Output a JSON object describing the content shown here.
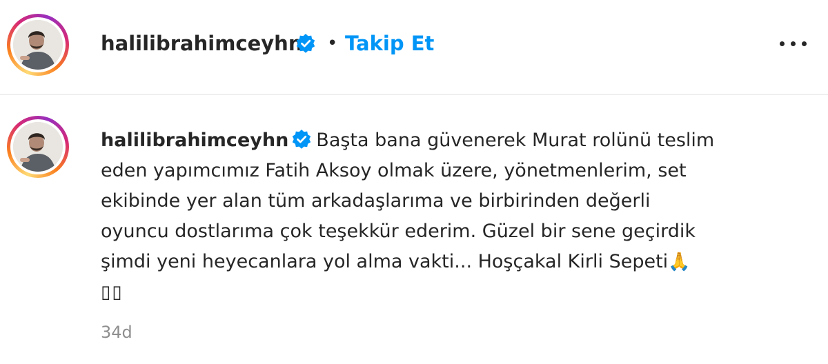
{
  "post": {
    "username": "halilibrahimceyhn",
    "separator": "•",
    "follow_label": "Takip Et",
    "more_icon": "more-horizontal-icon"
  },
  "caption": {
    "username": "halilibrahimceyhn",
    "lines": [
      "Başta bana güvenerek Murat rolünü teslim",
      "eden yapımcımız Fatih Aksoy olmak üzere, yönetmenlerim, set",
      "ekibinde yer alan tüm arkadaşlarıma ve birbirinden değerli",
      "oyuncu dostlarıma çok teşekkür ederim. Güzel bir sene geçirdik",
      "şimdi yeni heyecanlara yol alma vakti... Hoşçakal Kirli Sepeti"
    ],
    "emoji": "🙏",
    "trailing_glyphs": "▯▯",
    "timestamp": "34d"
  },
  "colors": {
    "accent": "#0095f6",
    "text": "#262626",
    "muted": "#8e8e8e",
    "divider": "#efefef"
  }
}
